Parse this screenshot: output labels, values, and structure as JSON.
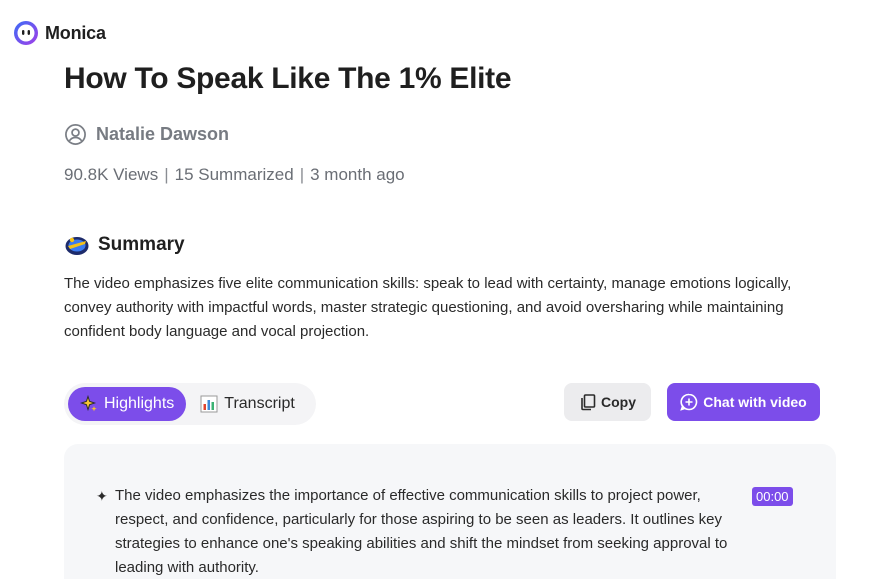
{
  "brand": {
    "name": "Monica",
    "icon": "monica-logo-icon",
    "accent": "#7c4dea"
  },
  "video": {
    "title": "How To Speak Like The 1% Elite",
    "author": "Natalie Dawson",
    "views": "90.8K Views",
    "summarized": "15 Summarized",
    "age": "3 month ago",
    "separator": "|"
  },
  "summary": {
    "heading": "Summary",
    "icon": "summary-icon",
    "text": "The video emphasizes five elite communication skills: speak to lead with certainty, manage emotions logically, convey authority with impactful words, master strategic questioning, and avoid oversharing while maintaining confident body language and vocal projection."
  },
  "tabs": [
    {
      "label": "Highlights",
      "icon": "sparkle-icon",
      "active": true
    },
    {
      "label": "Transcript",
      "icon": "bar-chart-icon",
      "active": false
    }
  ],
  "actions": {
    "copy_label": "Copy",
    "chat_label": "Chat with video"
  },
  "highlights": [
    {
      "bullet": "✦",
      "text": "The video emphasizes the importance of effective communication skills to project power, respect, and confidence, particularly for those aspiring to be seen as leaders. It outlines key strategies to enhance one's speaking abilities and shift the mindset from seeking approval to leading with authority.",
      "timestamp": "00:00"
    }
  ]
}
